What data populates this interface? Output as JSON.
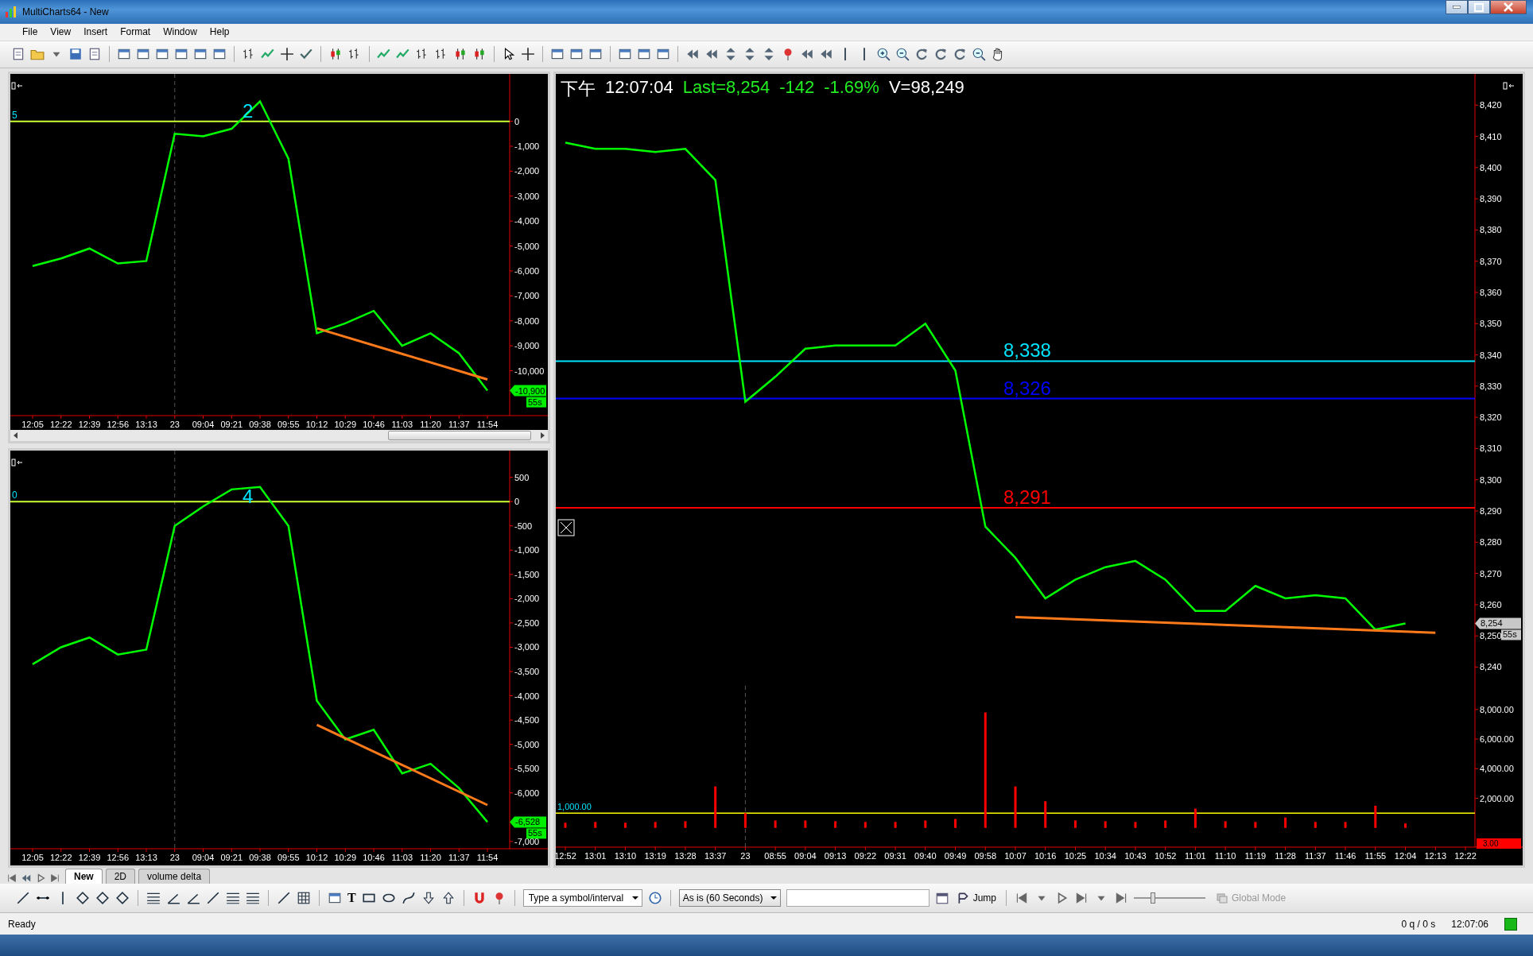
{
  "window": {
    "title": "MultiCharts64 - New"
  },
  "menu": [
    "File",
    "View",
    "Insert",
    "Format",
    "Window",
    "Help"
  ],
  "charts_left": [
    {
      "level_label": "5",
      "last_badge": {
        "label": "-10,900",
        "timer": "55s"
      },
      "chart_data": {
        "type": "line",
        "categories": [
          "12:05",
          "12:22",
          "12:39",
          "12:56",
          "13:13",
          "23",
          "09:04",
          "09:21",
          "09:38",
          "09:55",
          "10:12",
          "10:29",
          "10:46",
          "11:03",
          "11:20",
          "11:37",
          "11:54"
        ],
        "series": [
          {
            "color": "#00ff00",
            "values": [
              -5800,
              -5500,
              -5100,
              -5700,
              -5600,
              -500,
              -600,
              -300,
              800,
              -1500,
              -8500,
              -8100,
              -7600,
              -9000,
              -8500,
              -9300,
              -10800
            ]
          },
          {
            "color": "#ff7a1a",
            "values": [
              null,
              null,
              null,
              null,
              null,
              null,
              null,
              null,
              null,
              null,
              -8300,
              null,
              null,
              null,
              null,
              null,
              -10350
            ]
          }
        ],
        "ylim": [
          -11800,
          1900
        ],
        "yticks": [
          {
            "value": 0,
            "label": "0"
          },
          {
            "value": -1000,
            "label": "-1,000"
          },
          {
            "value": -2000,
            "label": "-2,000"
          },
          {
            "value": -3000,
            "label": "-3,000"
          },
          {
            "value": -4000,
            "label": "-4,000"
          },
          {
            "value": -5000,
            "label": "-5,000"
          },
          {
            "value": -6000,
            "label": "-6,000"
          },
          {
            "value": -7000,
            "label": "-7,000"
          },
          {
            "value": -8000,
            "label": "-8,000"
          },
          {
            "value": -9000,
            "label": "-9,000"
          },
          {
            "value": -10000,
            "label": "-10,000"
          }
        ],
        "ref_lines": [
          {
            "axis": "x",
            "value": "23",
            "color": "#555555"
          },
          {
            "axis": "y",
            "value": 0,
            "color": "#ccff33"
          }
        ],
        "annotations": [
          "2"
        ]
      }
    },
    {
      "level_label": "0",
      "last_badge": {
        "label": "-6,528",
        "timer": "55s"
      },
      "chart_data": {
        "type": "line",
        "categories": [
          "12:05",
          "12:22",
          "12:39",
          "12:56",
          "13:13",
          "23",
          "09:04",
          "09:21",
          "09:38",
          "09:55",
          "10:12",
          "10:29",
          "10:46",
          "11:03",
          "11:20",
          "11:37",
          "11:54"
        ],
        "series": [
          {
            "color": "#00ff00",
            "values": [
              -3350,
              -3000,
              -2800,
              -3150,
              -3050,
              -500,
              -100,
              250,
              300,
              -500,
              -4100,
              -4900,
              -4700,
              -5600,
              -5400,
              -5900,
              -6600
            ]
          },
          {
            "color": "#ff7a1a",
            "values": [
              null,
              null,
              null,
              null,
              null,
              null,
              null,
              null,
              null,
              null,
              -4600,
              null,
              null,
              null,
              null,
              null,
              -6250
            ]
          }
        ],
        "ylim": [
          -7150,
          1050
        ],
        "yticks": [
          {
            "value": 500,
            "label": "500"
          },
          {
            "value": 0,
            "label": "0"
          },
          {
            "value": -500,
            "label": "-500"
          },
          {
            "value": -1000,
            "label": "-1,000"
          },
          {
            "value": -1500,
            "label": "-1,500"
          },
          {
            "value": -2000,
            "label": "-2,000"
          },
          {
            "value": -2500,
            "label": "-2,500"
          },
          {
            "value": -3000,
            "label": "-3,000"
          },
          {
            "value": -3500,
            "label": "-3,500"
          },
          {
            "value": -4000,
            "label": "-4,000"
          },
          {
            "value": -4500,
            "label": "-4,500"
          },
          {
            "value": -5000,
            "label": "-5,000"
          },
          {
            "value": -5500,
            "label": "-5,500"
          },
          {
            "value": -6000,
            "label": "-6,000"
          },
          {
            "value": -7000,
            "label": "-7,000"
          }
        ],
        "ref_lines": [
          {
            "axis": "x",
            "value": "23",
            "color": "#555555"
          },
          {
            "axis": "y",
            "value": 0,
            "color": "#ccff33"
          }
        ],
        "annotations": [
          "4"
        ]
      }
    }
  ],
  "main_chart": {
    "header": {
      "period": "下午",
      "time": "12:07:04",
      "last": "Last=8,254",
      "change": "-142",
      "change_pct": "-1.69%",
      "volume": "V=98,249"
    },
    "price": {
      "last_badge": {
        "label": "8,254",
        "timer": "55s"
      },
      "chart_data": {
        "type": "line",
        "series": [
          {
            "color": "#00ff00",
            "values": [
              8408,
              8406,
              8406,
              8405,
              8406,
              8396,
              8325,
              8333,
              8342,
              8343,
              8343,
              8343,
              8350,
              8335,
              8285,
              8275,
              8262,
              8268,
              8272,
              8274,
              8268,
              8258,
              8258,
              8266,
              8262,
              8263,
              8262,
              8252,
              8254,
              null,
              null
            ]
          },
          {
            "color": "#ff7a1a",
            "values": [
              null,
              null,
              null,
              null,
              null,
              null,
              null,
              null,
              null,
              null,
              null,
              null,
              null,
              null,
              null,
              8256,
              null,
              null,
              null,
              null,
              null,
              null,
              null,
              null,
              null,
              null,
              null,
              null,
              null,
              8251,
              null
            ]
          }
        ],
        "ylim": [
          8234,
          8430
        ],
        "yticks": [
          {
            "value": 8420,
            "label": "8,420"
          },
          {
            "value": 8410,
            "label": "8,410"
          },
          {
            "value": 8400,
            "label": "8,400"
          },
          {
            "value": 8390,
            "label": "8,390"
          },
          {
            "value": 8380,
            "label": "8,380"
          },
          {
            "value": 8370,
            "label": "8,370"
          },
          {
            "value": 8360,
            "label": "8,360"
          },
          {
            "value": 8350,
            "label": "8,350"
          },
          {
            "value": 8340,
            "label": "8,340"
          },
          {
            "value": 8330,
            "label": "8,330"
          },
          {
            "value": 8320,
            "label": "8,320"
          },
          {
            "value": 8310,
            "label": "8,310"
          },
          {
            "value": 8300,
            "label": "8,300"
          },
          {
            "value": 8290,
            "label": "8,290"
          },
          {
            "value": 8280,
            "label": "8,280"
          },
          {
            "value": 8270,
            "label": "8,270"
          },
          {
            "value": 8260,
            "label": "8,260"
          },
          {
            "value": 8250,
            "label": "8,250"
          },
          {
            "value": 8240,
            "label": "8,240"
          }
        ],
        "ref_lines": [
          {
            "axis": "y",
            "value": 8338,
            "label": "8,338",
            "color": "#00e5ff"
          },
          {
            "axis": "y",
            "value": 8326,
            "label": "8,326",
            "color": "#0000ff"
          },
          {
            "axis": "y",
            "value": 8291,
            "label": "8,291",
            "color": "#ff0000"
          }
        ]
      }
    },
    "volume": {
      "chart_data": {
        "type": "bar",
        "categories": [
          "12:52",
          "13:01",
          "13:10",
          "13:19",
          "13:28",
          "13:37",
          "23",
          "08:55",
          "09:04",
          "09:13",
          "09:22",
          "09:31",
          "09:40",
          "09:49",
          "09:58",
          "10:07",
          "10:16",
          "10:25",
          "10:34",
          "10:43",
          "10:52",
          "11:01",
          "11:10",
          "11:19",
          "11:28",
          "11:37",
          "11:46",
          "11:55",
          "12:04",
          "12:13",
          "12:22"
        ],
        "series": [
          {
            "color": "#ff0000",
            "values": [
              350,
              400,
              350,
              400,
              450,
              2800,
              1000,
              500,
              500,
              450,
              400,
              400,
              500,
              600,
              7800,
              2800,
              1800,
              500,
              450,
              400,
              500,
              1300,
              450,
              400,
              700,
              400,
              400,
              1500,
              300,
              null,
              null
            ]
          }
        ],
        "ylim": [
          -1300,
          9600
        ],
        "yticks": [
          {
            "value": 2000,
            "label": "2,000.00"
          },
          {
            "value": 4000,
            "label": "4,000.00"
          },
          {
            "value": 6000,
            "label": "6,000.00"
          },
          {
            "value": 8000,
            "label": "8,000.00"
          }
        ],
        "ref_lines": [
          {
            "axis": "x",
            "value": "23",
            "color": "#555555"
          },
          {
            "axis": "y",
            "value": 1000,
            "label": "1,000.00",
            "color": "#ffff00"
          }
        ]
      },
      "scale_badge": "3.00"
    }
  },
  "bottom_tabs": [
    {
      "label": "New",
      "selected": true
    },
    {
      "label": "2D",
      "selected": false
    },
    {
      "label": "volume delta",
      "selected": false
    }
  ],
  "drawing_toolbar": {
    "text_tool": "T",
    "symbol_field": {
      "placeholder": "Type a symbol/interval"
    },
    "resolution": "As is (60 Seconds)",
    "jump": "Jump",
    "global_mode": {
      "label": "Global Mode",
      "disabled": true
    },
    "zoom_slider": {
      "level": 0.25
    }
  },
  "status_bar": {
    "message": "Ready",
    "queue": "0 q / 0 s",
    "time": "12:07:06"
  }
}
